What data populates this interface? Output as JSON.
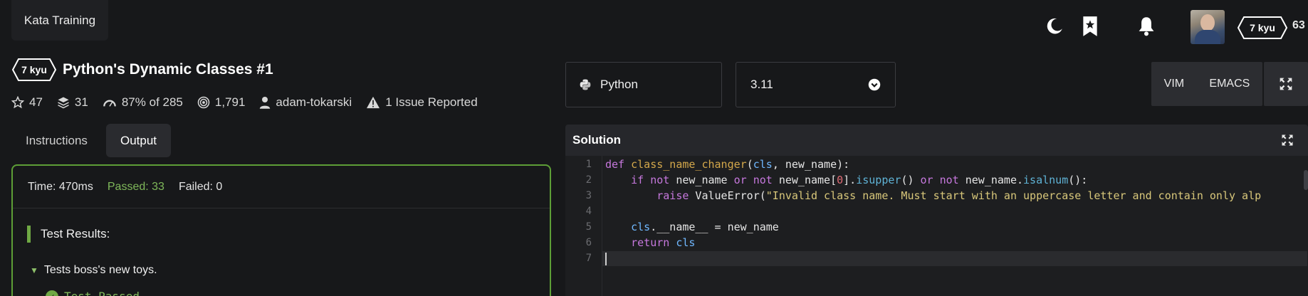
{
  "header": {
    "brand_label": "Kata Training",
    "kyu_label": "7 kyu",
    "honor": "63",
    "icons": [
      "moon-icon",
      "bookmark-star-icon",
      "bell-icon"
    ]
  },
  "kata": {
    "kyu_label": "7 kyu",
    "title": "Python's Dynamic Classes #1",
    "stats": {
      "stars": "47",
      "collections": "31",
      "satisfaction": "87%",
      "satisfaction_of": "of 285",
      "completed": "1,791",
      "author": "adam-tokarski",
      "issues": "1 Issue Reported"
    }
  },
  "tabs": {
    "instructions": "Instructions",
    "output": "Output"
  },
  "output": {
    "time": "Time: 470ms",
    "passed": "Passed: 33",
    "failed": "Failed: 0",
    "results_heading": "Test Results:",
    "describe": "Tests boss's new toys.",
    "passed_line": "Test Passed"
  },
  "editor_controls": {
    "language": "Python",
    "version": "3.11",
    "vim_label": "VIM",
    "emacs_label": "EMACS"
  },
  "solution": {
    "title": "Solution",
    "line_numbers": [
      "1",
      "2",
      "3",
      "4",
      "5",
      "6",
      "7"
    ],
    "code": {
      "l1_kw": "def",
      "l1_fn": "class_name_changer",
      "l1_open": "(",
      "l1_p1": "cls",
      "l1_rest": ", new_name):",
      "l2_indent": "    ",
      "l2_kw1": "if not",
      "l2_a": " new_name ",
      "l2_kw2": "or not",
      "l2_b": " new_name[",
      "l2_num": "0",
      "l2_c": "].",
      "l2_m1": "isupper",
      "l2_d": "() ",
      "l2_kw3": "or not",
      "l2_e": " new_name.",
      "l2_m2": "isalnum",
      "l2_f": "():",
      "l3_indent": "        ",
      "l3_kw": "raise",
      "l3_a": " ValueError(",
      "l3_str": "\"Invalid class name. Must start with an uppercase letter and contain only alp",
      "l5_indent": "    ",
      "l5_prm": "cls",
      "l5_rest": ".__name__ = new_name",
      "l6_indent": "    ",
      "l6_kw": "return",
      "l6_prm": " cls"
    }
  },
  "colors": {
    "background": "#17181a",
    "panel": "#26272b",
    "success_green": "#6fa844",
    "keyword": "#c678dd",
    "function": "#d4a84b",
    "string": "#d8c77a"
  }
}
